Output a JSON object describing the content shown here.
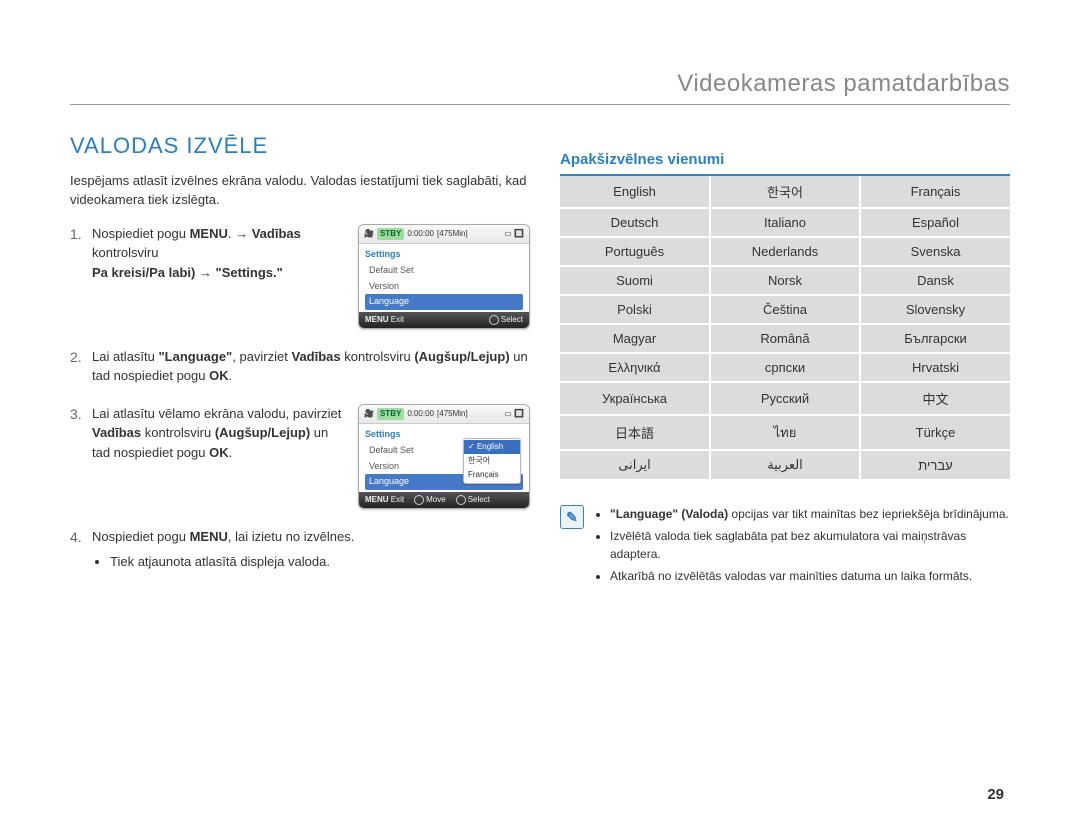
{
  "header": {
    "title": "Videokameras pamatdarbības"
  },
  "section": {
    "title": "VALODAS IZVĒLE"
  },
  "intro": "Iespējams atlasīt izvēlnes ekrāna valodu. Valodas iestatījumi tiek saglabāti, kad videokamera tiek izslēgta.",
  "steps": {
    "s1a": "Nospiediet pogu ",
    "s1b": "MENU",
    "s1c": ". → ",
    "s1d": "Vadības",
    "s1e": " kontrolsviru ",
    "s1f": "Pa kreisi/Pa labi) → \"Settings.\"",
    "s2a": "Lai atlasītu ",
    "s2b": "\"Language\"",
    "s2c": ", pavirziet ",
    "s2d": "Vadības",
    "s2e": " kontrolsviru ",
    "s2f": "(Augšup/Lejup)",
    "s2g": " un tad nospiediet pogu ",
    "s2h": "OK",
    "s2i": ".",
    "s3a": "Lai atlasītu vēlamo ekrāna valodu, pavirziet ",
    "s3b": "Vadības",
    "s3c": " kontrolsviru ",
    "s3d": "(Augšup/Lejup)",
    "s3e": " un tad nospiediet pogu ",
    "s3f": "OK",
    "s3g": ".",
    "s4a": "Nospiediet pogu ",
    "s4b": "MENU",
    "s4c": ", lai izietu no izvēlnes.",
    "s4_sub1": "Tiek atjaunota atlasītā displeja valoda."
  },
  "lcd": {
    "stby": "STBY",
    "time": "0:00:00",
    "remain": "[475Min]",
    "settings": "Settings",
    "default_set": "Default Set",
    "version": "Version",
    "language": "Language",
    "menu": "MENU",
    "exit": "Exit",
    "move": "Move",
    "select": "Select",
    "lang_en": "English",
    "lang_ko": "한국어",
    "lang_fr": "Français"
  },
  "submenu": {
    "title": "Apakšizvēlnes vienumi"
  },
  "languages": [
    [
      "English",
      "한국어",
      "Français"
    ],
    [
      "Deutsch",
      "Italiano",
      "Español"
    ],
    [
      "Português",
      "Nederlands",
      "Svenska"
    ],
    [
      "Suomi",
      "Norsk",
      "Dansk"
    ],
    [
      "Polski",
      "Čeština",
      "Slovensky"
    ],
    [
      "Magyar",
      "Română",
      "Български"
    ],
    [
      "Ελληνικά",
      "српски",
      "Hrvatski"
    ],
    [
      "Українська",
      "Русский",
      "中文"
    ],
    [
      "日本語",
      "ไทย",
      "Türkçe"
    ],
    [
      "ایرانی",
      "العربية",
      "עברית"
    ]
  ],
  "notes": {
    "n1a": "\"Language\" (Valoda)",
    "n1b": " opcijas var tikt mainītas bez iepriekšēja brīdinājuma.",
    "n2": "Izvēlētā valoda tiek saglabāta pat bez akumulatora vai maiņstrāvas adaptera.",
    "n3": "Atkarībā no izvēlētās valodas var mainīties datuma un laika formāts."
  },
  "page_number": "29"
}
